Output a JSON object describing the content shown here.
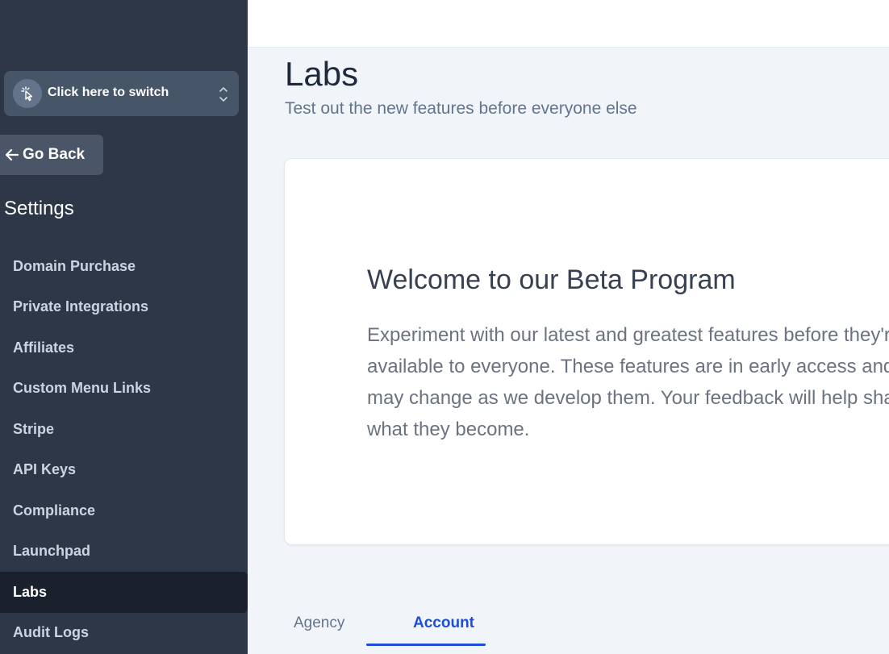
{
  "sidebar": {
    "switcher": {
      "label": "Click here to switch"
    },
    "go_back": {
      "label": "Go Back"
    },
    "section_title": "Settings",
    "items": [
      {
        "label": "Domain Purchase",
        "active": false
      },
      {
        "label": "Private Integrations",
        "active": false
      },
      {
        "label": "Affiliates",
        "active": false
      },
      {
        "label": "Custom Menu Links",
        "active": false
      },
      {
        "label": "Stripe",
        "active": false
      },
      {
        "label": "API Keys",
        "active": false
      },
      {
        "label": "Compliance",
        "active": false
      },
      {
        "label": "Launchpad",
        "active": false
      },
      {
        "label": "Labs",
        "active": true
      },
      {
        "label": "Audit Logs",
        "active": false
      }
    ]
  },
  "main": {
    "title": "Labs",
    "subtitle": "Test out the new features before everyone else",
    "card": {
      "title": "Welcome to our Beta Program",
      "description": "Experiment with our latest and greatest features before they're available to everyone. These features are in early access and may change as we develop them. Your feedback will help shape what they become."
    },
    "tabs": [
      {
        "label": "Agency",
        "active": false
      },
      {
        "label": "Account",
        "active": true
      }
    ]
  },
  "colors": {
    "sidebar_bg": "#2d3748",
    "active_item_bg": "#1a202c",
    "accent": "#1d4ed8"
  },
  "icons": {
    "switcher": "cursor-click-icon",
    "switcher_chevrons": "chevron-up-down-icon",
    "go_back": "arrow-left-icon"
  }
}
